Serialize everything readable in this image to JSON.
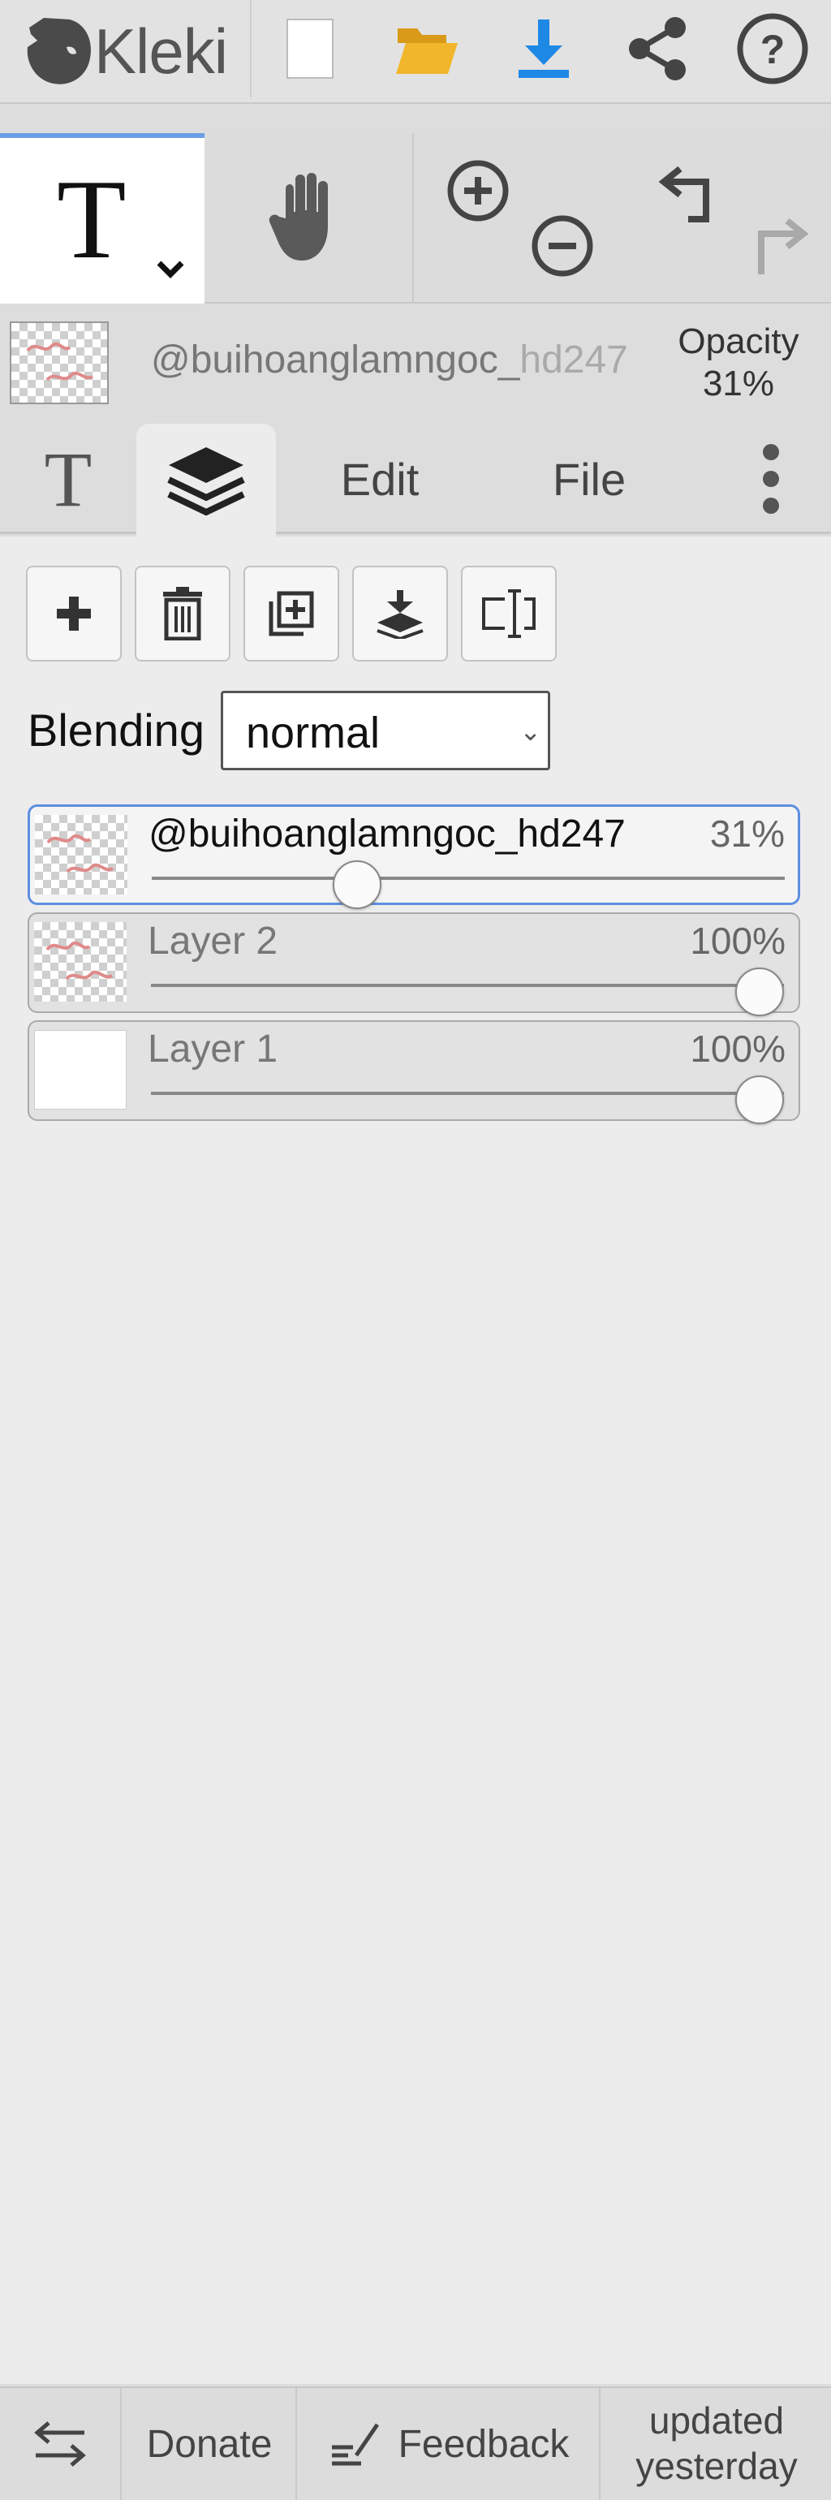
{
  "app": {
    "logo_text": "Kleki"
  },
  "toolbar": {
    "buttons": [
      {
        "name": "new-image-icon"
      },
      {
        "name": "open-folder-icon"
      },
      {
        "name": "download-icon"
      },
      {
        "name": "share-icon"
      },
      {
        "name": "help-icon"
      }
    ],
    "accent_color": "#1e88e5",
    "folder_color": "#f2b62c"
  },
  "tools": {
    "active_tool_glyph": "T",
    "hand_tool": "hand-icon",
    "zoom_in": "zoom-in-icon",
    "zoom_out": "zoom-out-icon",
    "undo": "undo-icon",
    "redo": "redo-icon"
  },
  "current_layer": {
    "name_main": "@buihoanglamngoc_",
    "name_faded": "hd247",
    "opacity_label": "Opacity",
    "opacity_value": "31%"
  },
  "tabs": [
    {
      "label": "T",
      "icon": "text-tool-icon"
    },
    {
      "label": "",
      "icon": "layers-icon",
      "active": true
    },
    {
      "label": "Edit"
    },
    {
      "label": "File"
    },
    {
      "label": "",
      "icon": "more-vertical-icon"
    }
  ],
  "layer_actions": [
    {
      "name": "add-layer-icon"
    },
    {
      "name": "delete-layer-icon"
    },
    {
      "name": "duplicate-layer-icon"
    },
    {
      "name": "merge-down-icon"
    },
    {
      "name": "rename-layer-icon"
    }
  ],
  "blending": {
    "label": "Blending",
    "value": "normal"
  },
  "layers": [
    {
      "name": "@buihoanglamngoc_hd247",
      "opacity": "31%",
      "opacity_fraction": 0.31,
      "selected": true,
      "thumb": "transparent"
    },
    {
      "name": "Layer 2",
      "opacity": "100%",
      "opacity_fraction": 1.0,
      "selected": false,
      "thumb": "transparent"
    },
    {
      "name": "Layer 1",
      "opacity": "100%",
      "opacity_fraction": 1.0,
      "selected": false,
      "thumb": "white"
    }
  ],
  "footer": {
    "swap_icon": "swap-icon",
    "donate_label": "Donate",
    "feedback_label": "Feedback",
    "feedback_icon": "feedback-icon",
    "updated_line1": "updated",
    "updated_line2": "yesterday"
  }
}
